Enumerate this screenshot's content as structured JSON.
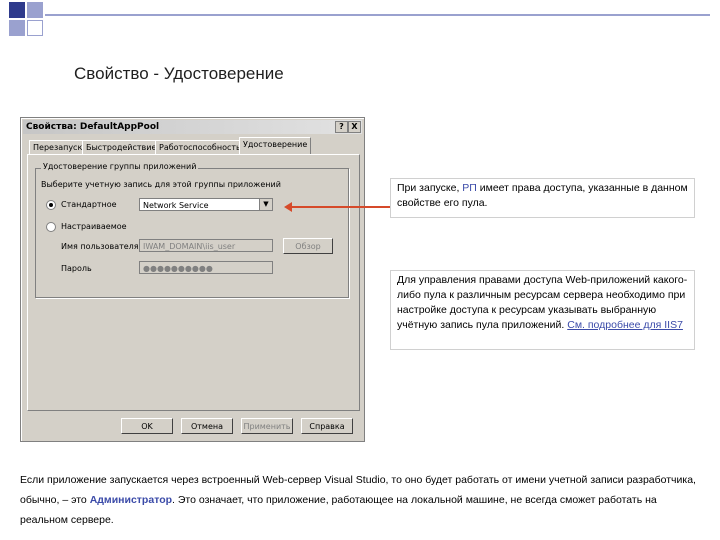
{
  "slide": {
    "title": "Свойство - Удостоверение"
  },
  "dialog": {
    "title": "Свойства: DefaultAppPool",
    "help_button": "?",
    "close_button": "X",
    "tabs": [
      "Перезапуск",
      "Быстродействие",
      "Работоспособность",
      "Удостоверение"
    ],
    "active_tab": "Удостоверение",
    "group_label": "Удостоверение группы приложений",
    "group_prompt": "Выберите учетную запись для этой группы приложений",
    "predefined_label": "Стандартное",
    "predefined_value": "Network Service",
    "configurable_label": "Настраиваемое",
    "username_label": "Имя пользователя",
    "username_value": "IWAM_DOMAIN\\iis_user",
    "browse_button": "Обзор",
    "password_label": "Пароль",
    "password_value": "●●●●●●●●●●",
    "buttons": {
      "ok": "OK",
      "cancel": "Отмена",
      "apply": "Применить",
      "help": "Справка"
    },
    "dropdown_icon": "triangle-down-icon",
    "selected_radio": "predefined"
  },
  "callouts": {
    "first_before": "При запуске, ",
    "first_accent": "РП",
    "first_after": " имеет права доступа, указанные в данном свойстве его пула.",
    "second_text": "Для управления правами доступа Web-приложений какого-либо пула к различным ресурсам сервера необходимо при настройке доступа к ресурсам указывать выбранную учётную запись пула приложений. ",
    "second_link": "См. подробнее для IIS7"
  },
  "footer": {
    "before": "Если приложение запускается через встроенный Web-сервер Visual Studio, то оно будет работать от имени учетной записи разработчика, обычно, – это ",
    "bold": "Администратор",
    "after": ". Это означает, что приложение, работающее на локальной машине, не всегда сможет работать на реальном сервере."
  },
  "colors": {
    "accent": "#3a4aa8",
    "arrow": "#d64a2a",
    "deco_dark": "#2e3a8c",
    "deco_light": "#9aa1cf"
  }
}
